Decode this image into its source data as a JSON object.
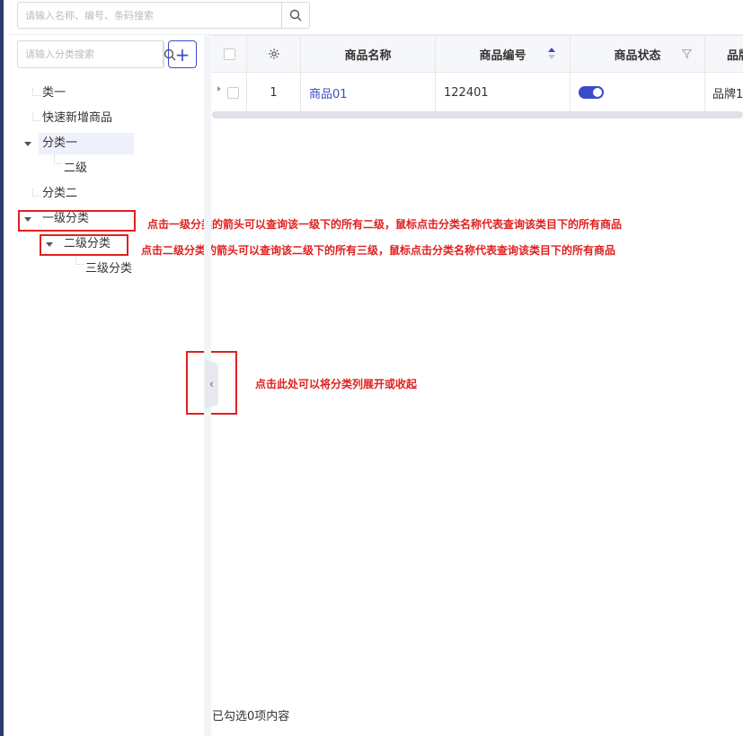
{
  "search": {
    "placeholder": "请输入名称、编号、条码搜索"
  },
  "category": {
    "placeholder": "请输入分类搜索",
    "add_label": "+",
    "tree": [
      "类一",
      "快速新增商品",
      "分类一",
      "二级",
      "分类二",
      "一级分类",
      "二级分类",
      "三级分类"
    ]
  },
  "table": {
    "headers": {
      "name": "商品名称",
      "code": "商品编号",
      "status": "商品状态",
      "brand": "品牌"
    },
    "rows": [
      {
        "index": "1",
        "name": "商品01",
        "code": "122401",
        "status": "on",
        "brand": "品牌1"
      }
    ]
  },
  "annotations": {
    "level1": "点击一级分类的箭头可以查询该一级下的所有二级，鼠标点击分类名称代表查询该类目下的所有商品",
    "level2": "点击二级分类的箭头可以查询该二级下的所有三级，鼠标点击分类名称代表查询该类目下的所有商品",
    "toggle": "点击此处可以将分类列展开或收起"
  },
  "footer": {
    "selected_text": "已勾选0项内容"
  },
  "colors": {
    "accent": "#3b4bc8",
    "annotation": "#e02020",
    "sidebar_edge": "#2f3a6e"
  }
}
